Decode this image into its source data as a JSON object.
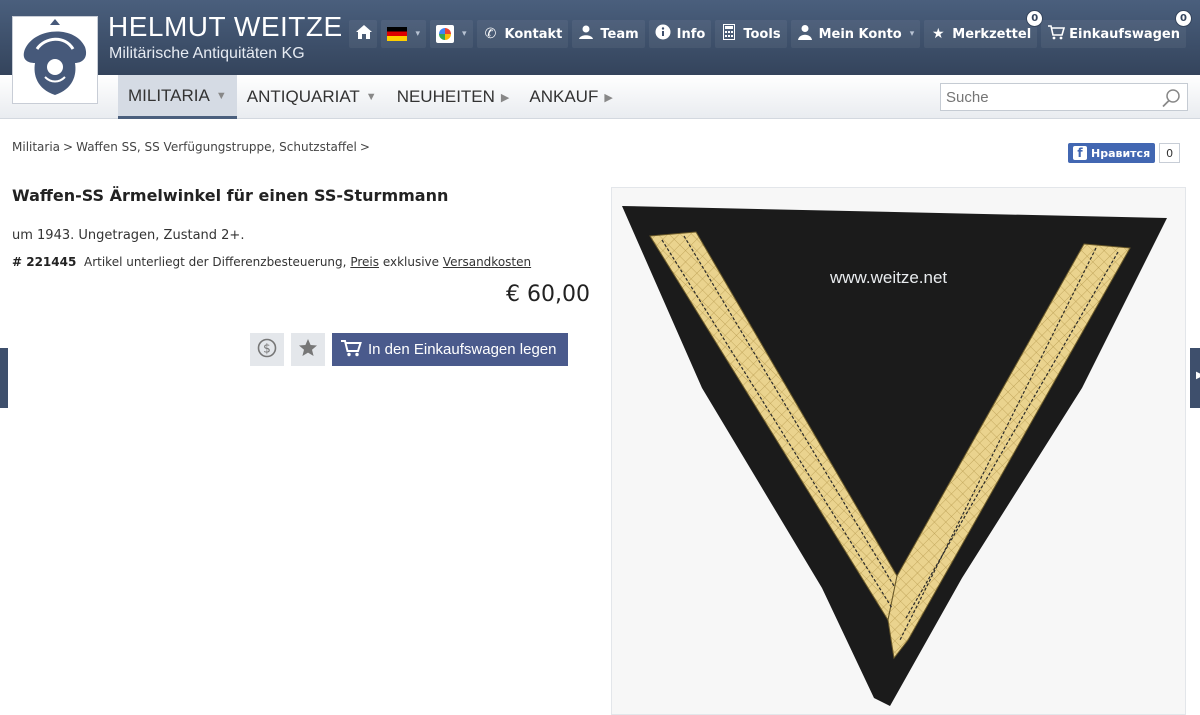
{
  "brand": {
    "title": "HELMUT WEITZE",
    "subtitle": "Militärische Antiquitäten KG"
  },
  "topnav": {
    "items": [
      {
        "icon": "home-icon"
      },
      {
        "icon": "flag-de-icon"
      },
      {
        "icon": "google-icon"
      },
      {
        "icon": "phone-icon",
        "label": "Kontakt"
      },
      {
        "icon": "team-icon",
        "label": "Team"
      },
      {
        "icon": "info-icon",
        "label": "Info"
      },
      {
        "icon": "calculator-icon",
        "label": "Tools"
      },
      {
        "icon": "user-icon",
        "label": "Mein Konto"
      },
      {
        "icon": "star-icon",
        "label": "Merkzettel",
        "badge": "0"
      },
      {
        "icon": "cart-icon",
        "label": "Einkaufswagen",
        "badge": "0"
      }
    ]
  },
  "mainnav": {
    "items": [
      {
        "label": "MILITARIA"
      },
      {
        "label": "ANTIQUARIAT"
      },
      {
        "label": "NEUHEITEN"
      },
      {
        "label": "ANKAUF"
      }
    ]
  },
  "search": {
    "placeholder": "Suche"
  },
  "breadcrumb": {
    "items": [
      "Militaria",
      "Waffen SS, SS Verfügungstruppe, Schutzstaffel"
    ]
  },
  "facebook": {
    "label": "Нравится",
    "count": "0"
  },
  "product": {
    "title": "Waffen-SS Ärmelwinkel für einen SS-Sturmmann",
    "description": "um 1943. Ungetragen, Zustand 2+.",
    "sku": "# 221445",
    "tax_note": "Artikel unterliegt der Differenzbesteuerung,",
    "price_link": "Preis",
    "excl": "exklusive",
    "shipping_link": "Versandkosten",
    "price": "€ 60,00",
    "cart_button": "In den Einkaufswagen legen",
    "watermark": "www.weitze.net"
  },
  "colors": {
    "header": "#3e4f6c",
    "button": "#4a5a8c",
    "gold": "#e8cf85"
  }
}
